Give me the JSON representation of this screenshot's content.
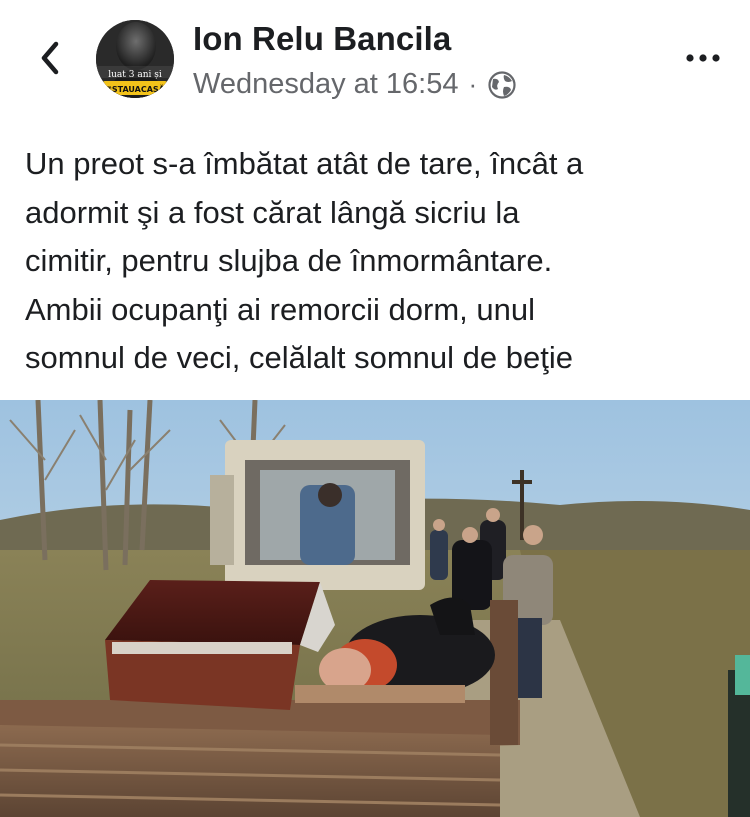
{
  "header": {
    "author_name": "Ion Relu Bancila",
    "timestamp": "Wednesday at 16:54",
    "separator": "·",
    "privacy_icon": "globe-icon",
    "back_icon": "chevron-left-icon",
    "more_icon": "more-horizontal-icon"
  },
  "avatar": {
    "caption_top": "luat 3 ani și",
    "caption_bottom": "#STAUACASĂ"
  },
  "post": {
    "lines": [
      "Un preot s-a îmbătat atât de tare, încât a",
      "adormit şi a fost cărat lângă sicriu la",
      "cimitir, pentru slujba de înmormântare.",
      "Ambii ocupanţi ai remorcii dorm, unul",
      "somnul de veci, celălalt somnul de beţie"
    ]
  },
  "colors": {
    "text": "#1c1e21",
    "secondary": "#65676b",
    "background": "#ffffff"
  }
}
